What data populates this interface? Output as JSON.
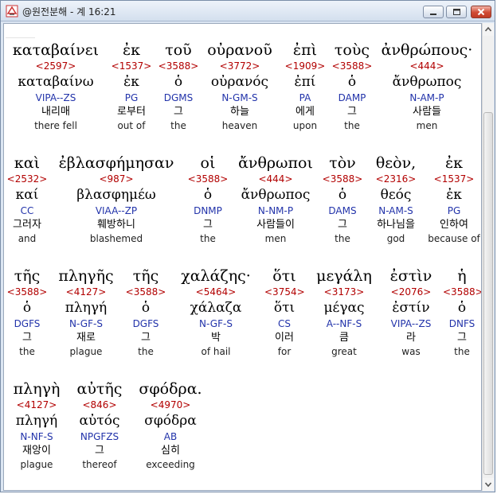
{
  "window": {
    "title": "@원전분해 - 계 16:21"
  },
  "rows": [
    [
      {
        "greek": "καταβαίνει",
        "strong": "<2597>",
        "lexeme": "καταβαίνω",
        "parse": "VIPA--ZS",
        "korean": "내리매",
        "english": "there fell"
      },
      {
        "greek": "ἐκ",
        "strong": "<1537>",
        "lexeme": "ἐκ",
        "parse": "PG",
        "korean": "로부터",
        "english": "out of"
      },
      {
        "greek": "τοῦ",
        "strong": "<3588>",
        "lexeme": "ὁ",
        "parse": "DGMS",
        "korean": "그",
        "english": "the"
      },
      {
        "greek": "οὐρανοῦ",
        "strong": "<3772>",
        "lexeme": "οὐρανός",
        "parse": "N-GM-S",
        "korean": "하늘",
        "english": "heaven"
      },
      {
        "greek": "ἐπὶ",
        "strong": "<1909>",
        "lexeme": "ἐπί",
        "parse": "PA",
        "korean": "에게",
        "english": "upon"
      },
      {
        "greek": "τοὺς",
        "strong": "<3588>",
        "lexeme": "ὁ",
        "parse": "DAMP",
        "korean": "그",
        "english": "the"
      },
      {
        "greek": "ἀνθρώπους·",
        "strong": "<444>",
        "lexeme": "ἄνθρωπος",
        "parse": "N-AM-P",
        "korean": "사람들",
        "english": "men"
      }
    ],
    [
      {
        "greek": "καὶ",
        "strong": "<2532>",
        "lexeme": "καί",
        "parse": "CC",
        "korean": "그러자",
        "english": "and"
      },
      {
        "greek": "ἐβλασφήμησαν",
        "strong": "<987>",
        "lexeme": "βλασφημέω",
        "parse": "VIAA--ZP",
        "korean": "훼방하니",
        "english": "blashemed"
      },
      {
        "greek": "οἱ",
        "strong": "<3588>",
        "lexeme": "ὁ",
        "parse": "DNMP",
        "korean": "그",
        "english": "the"
      },
      {
        "greek": "ἄνθρωποι",
        "strong": "<444>",
        "lexeme": "ἄνθρωπος",
        "parse": "N-NM-P",
        "korean": "사람들이",
        "english": "men"
      },
      {
        "greek": "τὸν",
        "strong": "<3588>",
        "lexeme": "ὁ",
        "parse": "DAMS",
        "korean": "그",
        "english": "the"
      },
      {
        "greek": "θεὸν,",
        "strong": "<2316>",
        "lexeme": "θεός",
        "parse": "N-AM-S",
        "korean": "하나님을",
        "english": "god"
      },
      {
        "greek": "ἐκ",
        "strong": "<1537>",
        "lexeme": "ἐκ",
        "parse": "PG",
        "korean": "인하여",
        "english": "because of"
      }
    ],
    [
      {
        "greek": "τῆς",
        "strong": "<3588>",
        "lexeme": "ὁ",
        "parse": "DGFS",
        "korean": "그",
        "english": "the"
      },
      {
        "greek": "πληγῆς",
        "strong": "<4127>",
        "lexeme": "πληγή",
        "parse": "N-GF-S",
        "korean": "재로",
        "english": "plague"
      },
      {
        "greek": "τῆς",
        "strong": "<3588>",
        "lexeme": "ὁ",
        "parse": "DGFS",
        "korean": "그",
        "english": "the"
      },
      {
        "greek": "χαλάζης·",
        "strong": "<5464>",
        "lexeme": "χάλαζα",
        "parse": "N-GF-S",
        "korean": "박",
        "english": "of hail"
      },
      {
        "greek": "ὅτι",
        "strong": "<3754>",
        "lexeme": "ὅτι",
        "parse": "CS",
        "korean": "이러",
        "english": "for"
      },
      {
        "greek": "μεγάλη",
        "strong": "<3173>",
        "lexeme": "μέγας",
        "parse": "A--NF-S",
        "korean": "큼",
        "english": "great"
      },
      {
        "greek": "ἐστὶν",
        "strong": "<2076>",
        "lexeme": "ἐστίν",
        "parse": "VIPA--ZS",
        "korean": "라",
        "english": "was"
      },
      {
        "greek": "ἡ",
        "strong": "<3588>",
        "lexeme": "ὁ",
        "parse": "DNFS",
        "korean": "그",
        "english": "the"
      }
    ],
    [
      {
        "greek": "πληγὴ",
        "strong": "<4127>",
        "lexeme": "πληγή",
        "parse": "N-NF-S",
        "korean": "재앙이",
        "english": "plague"
      },
      {
        "greek": "αὐτῆς",
        "strong": "<846>",
        "lexeme": "αὐτός",
        "parse": "NPGFZS",
        "korean": "그",
        "english": "thereof"
      },
      {
        "greek": "σφόδρα.",
        "strong": "<4970>",
        "lexeme": "σφόδρα",
        "parse": "AB",
        "korean": "심히",
        "english": "exceeding"
      }
    ]
  ]
}
